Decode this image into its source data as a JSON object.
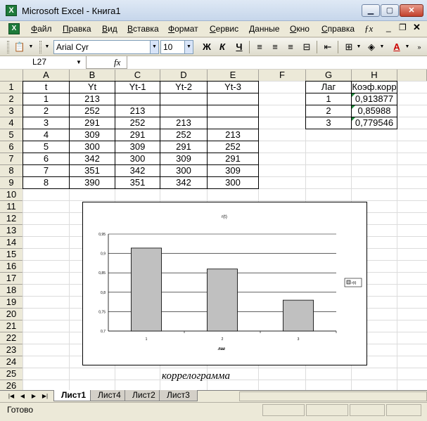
{
  "window": {
    "title": "Microsoft Excel - Книга1"
  },
  "menu": [
    "Файл",
    "Правка",
    "Вид",
    "Вставка",
    "Формат",
    "Сервис",
    "Данные",
    "Окно",
    "Справка"
  ],
  "menu_glyphs": {
    "ask": "ƒx",
    "minimize": "_",
    "restore": "❐",
    "close": "✕"
  },
  "toolbar": {
    "font": "Arial Cyr",
    "size": "10",
    "bold": "Ж",
    "italic": "К",
    "underline": "Ч"
  },
  "formula_bar": {
    "name_box": "L27",
    "fx": "fx",
    "value": ""
  },
  "columns": [
    "A",
    "B",
    "C",
    "D",
    "E",
    "F",
    "G",
    "H"
  ],
  "rows": [
    "1",
    "2",
    "3",
    "4",
    "5",
    "6",
    "7",
    "8",
    "9",
    "10",
    "11",
    "12",
    "13",
    "14",
    "15",
    "16",
    "17",
    "18",
    "19",
    "20",
    "21",
    "22",
    "23",
    "24",
    "25",
    "26"
  ],
  "table_main": {
    "headers": [
      "t",
      "Yt",
      "Yt-1",
      "Yt-2",
      "Yt-3"
    ],
    "rows": [
      [
        "1",
        "213",
        "",
        "",
        ""
      ],
      [
        "2",
        "252",
        "213",
        "",
        ""
      ],
      [
        "3",
        "291",
        "252",
        "213",
        ""
      ],
      [
        "4",
        "309",
        "291",
        "252",
        "213"
      ],
      [
        "5",
        "300",
        "309",
        "291",
        "252"
      ],
      [
        "6",
        "342",
        "300",
        "309",
        "291"
      ],
      [
        "7",
        "351",
        "342",
        "300",
        "309"
      ],
      [
        "8",
        "390",
        "351",
        "342",
        "300"
      ]
    ]
  },
  "table_lag": {
    "headers": [
      "Лаг",
      "Коэф.корр"
    ],
    "rows": [
      [
        "1",
        "0,913877"
      ],
      [
        "2",
        "0,85988"
      ],
      [
        "3",
        "0,779546"
      ]
    ]
  },
  "chart_data": {
    "type": "bar",
    "title": "r(t)",
    "categories": [
      "1",
      "2",
      "3"
    ],
    "series": [
      {
        "name": "r(t)",
        "values": [
          0.913877,
          0.85988,
          0.779546
        ]
      }
    ],
    "xlabel": "лаг",
    "ylabel": "",
    "ylim": [
      0.7,
      0.95
    ],
    "yticks": [
      "0,7",
      "0,75",
      "0,8",
      "0,85",
      "0,9",
      "0,95"
    ],
    "grid": true,
    "legend": "right",
    "bar_color": "#c0c0c0"
  },
  "caption": "коррелограмма",
  "sheets": [
    "Лист1",
    "Лист4",
    "Лист2",
    "Лист3"
  ],
  "active_sheet": "Лист1",
  "status": "Готово"
}
